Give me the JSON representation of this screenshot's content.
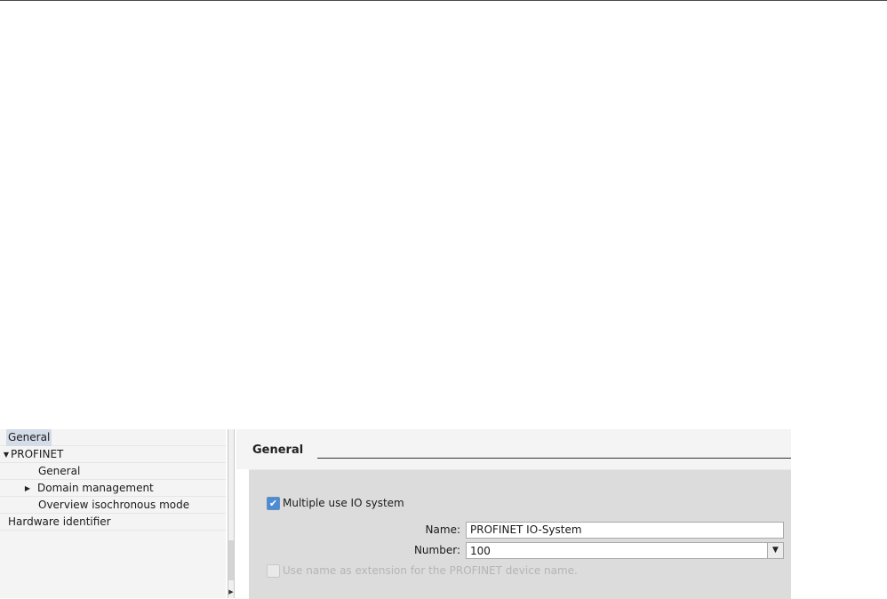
{
  "nav": {
    "items": [
      {
        "label": "General",
        "level": 0,
        "selected": true
      },
      {
        "label": "PROFINET",
        "level": 0,
        "expanded": true,
        "arrow": "▼"
      },
      {
        "label": "General",
        "level": 1
      },
      {
        "label": "Domain management",
        "level": 1,
        "collapsed": true,
        "arrow": "▶"
      },
      {
        "label": "Overview isochronous mode",
        "level": 1
      },
      {
        "label": "Hardware identifier",
        "level": 0
      }
    ]
  },
  "content": {
    "section_title": "General",
    "multiple_use": {
      "label": "Multiple use IO system",
      "checked": true
    },
    "name_field": {
      "label": "Name:",
      "value": "PROFINET IO-System"
    },
    "number_field": {
      "label": "Number:",
      "value": "100"
    },
    "use_name_ext": {
      "label": "Use name as extension for the PROFINET device name.",
      "checked": false,
      "enabled": false
    }
  },
  "icons": {
    "check": "✔",
    "dropdown": "▼",
    "scroll_left": "◀",
    "scroll_right": "▶"
  },
  "colors": {
    "selection": "#d4dce8",
    "panel": "#dcdcdc",
    "checkbox_accent": "#4a8dd6"
  }
}
